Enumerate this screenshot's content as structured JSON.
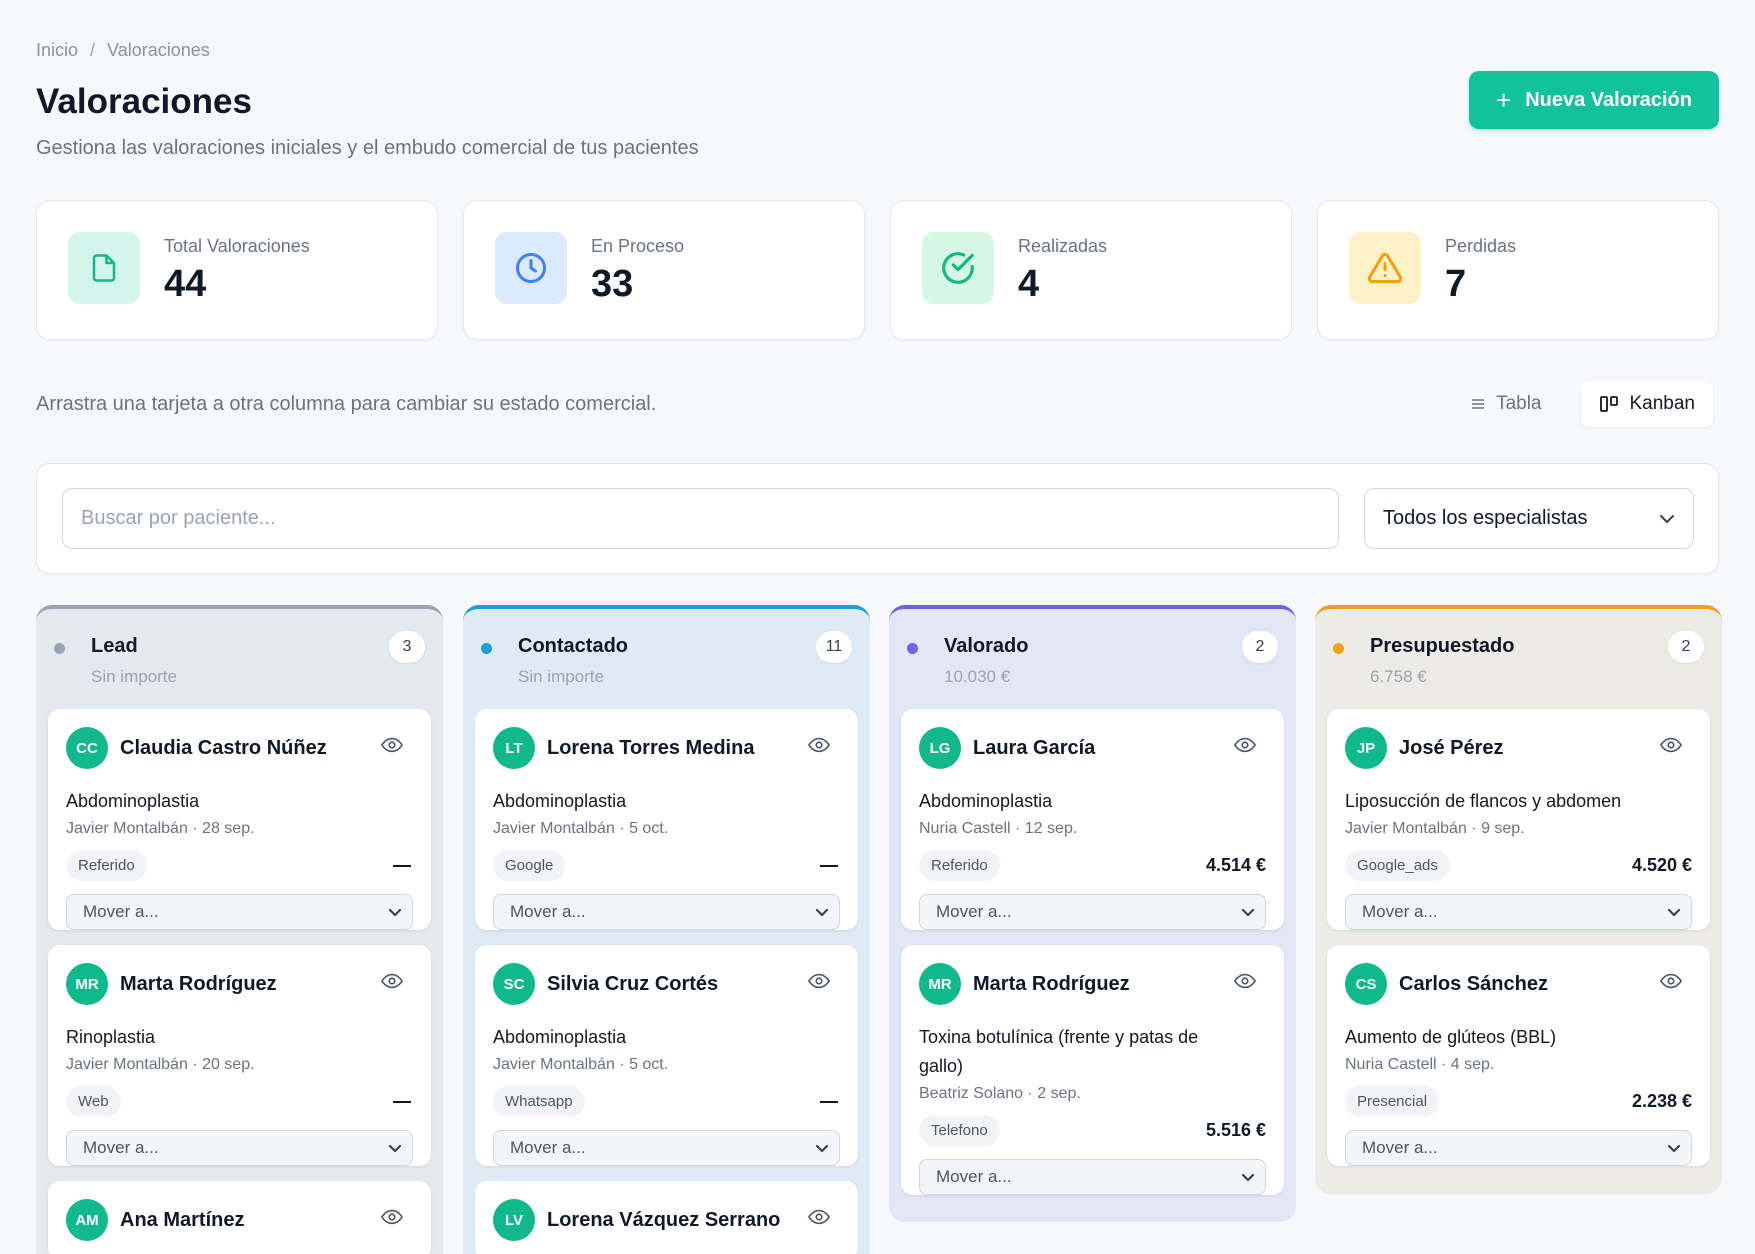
{
  "breadcrumb": {
    "home": "Inicio",
    "separator": "/",
    "current": "Valoraciones"
  },
  "header": {
    "title": "Valoraciones",
    "subtitle": "Gestiona las valoraciones iniciales y el embudo comercial de tus pacientes",
    "new_button": "Nueva Valoración"
  },
  "stats": [
    {
      "label": "Total Valoraciones",
      "value": "44",
      "icon": "document-icon",
      "color": "#10b98c",
      "bg": "#d4f5ec"
    },
    {
      "label": "En Proceso",
      "value": "33",
      "icon": "clock-icon",
      "color": "#3b82f6",
      "bg": "#dbeafe"
    },
    {
      "label": "Realizadas",
      "value": "4",
      "icon": "check-circle-icon",
      "color": "#10b981",
      "bg": "#d7f7e6"
    },
    {
      "label": "Perdidas",
      "value": "7",
      "icon": "warning-icon",
      "color": "#f59e0b",
      "bg": "#fdf1c8"
    }
  ],
  "hint": "Arrastra una tarjeta a otra columna para cambiar su estado comercial.",
  "view_toggle": {
    "table": "Tabla",
    "kanban": "Kanban",
    "active": "kanban"
  },
  "filters": {
    "search_placeholder": "Buscar por paciente...",
    "specialist_value": "Todos los especialistas"
  },
  "move_label": "Mover a...",
  "columns": [
    {
      "name": "Lead",
      "count": "3",
      "amount": "Sin importe",
      "accent": "#9aa3b2",
      "bg": "#e4e8ef",
      "cards": [
        {
          "initials": "CC",
          "patient": "Claudia Castro Núñez",
          "treatment": "Abdominoplastia",
          "meta": "Javier Montalbán · 28 sep.",
          "tag": "Referido",
          "price": ""
        },
        {
          "initials": "MR",
          "patient": "Marta Rodríguez",
          "treatment": "Rinoplastia",
          "meta": "Javier Montalbán · 20 sep.",
          "tag": "Web",
          "price": ""
        },
        {
          "initials": "AM",
          "patient": "Ana Martínez",
          "treatment": "",
          "meta": "",
          "tag": "",
          "price": ""
        }
      ]
    },
    {
      "name": "Contactado",
      "count": "11",
      "amount": "Sin importe",
      "accent": "#1aa0d8",
      "bg": "#deebf4",
      "cards": [
        {
          "initials": "LT",
          "patient": "Lorena Torres Medina",
          "treatment": "Abdominoplastia",
          "meta": "Javier Montalbán · 5 oct.",
          "tag": "Google",
          "price": ""
        },
        {
          "initials": "SC",
          "patient": "Silvia Cruz Cortés",
          "treatment": "Abdominoplastia",
          "meta": "Javier Montalbán · 5 oct.",
          "tag": "Whatsapp",
          "price": ""
        },
        {
          "initials": "LV",
          "patient": "Lorena Vázquez Serrano",
          "treatment": "",
          "meta": "",
          "tag": "",
          "price": ""
        }
      ]
    },
    {
      "name": "Valorado",
      "count": "2",
      "amount": "10.030 €",
      "accent": "#6c63e6",
      "bg": "#e3e6f4",
      "cards": [
        {
          "initials": "LG",
          "patient": "Laura García",
          "treatment": "Abdominoplastia",
          "meta": "Nuria Castell · 12 sep.",
          "tag": "Referido",
          "price": "4.514 €"
        },
        {
          "initials": "MR",
          "patient": "Marta Rodríguez",
          "treatment": "Toxina botulínica (frente y patas de gallo)",
          "meta": "Beatriz Solano · 2 sep.",
          "tag": "Telefono",
          "price": "5.516 €"
        }
      ]
    },
    {
      "name": "Presupuestado",
      "count": "2",
      "amount": "6.758 €",
      "accent": "#f0a020",
      "bg": "#ecebe6",
      "cards": [
        {
          "initials": "JP",
          "patient": "José Pérez",
          "treatment": "Liposucción de flancos y abdomen",
          "meta": "Javier Montalbán · 9 sep.",
          "tag": "Google_ads",
          "price": "4.520 €"
        },
        {
          "initials": "CS",
          "patient": "Carlos Sánchez",
          "treatment": "Aumento de glúteos (BBL)",
          "meta": "Nuria Castell · 4 sep.",
          "tag": "Presencial",
          "price": "2.238 €"
        }
      ]
    }
  ]
}
